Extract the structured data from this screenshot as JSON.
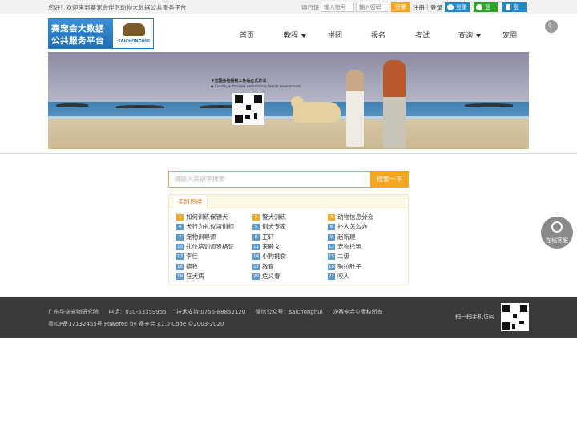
{
  "topbar": {
    "welcome": "您好！欢迎来到赛宠会伴侣动物大数据公共服务平台",
    "pass_label": "通行证",
    "account_placeholder": "输入账号",
    "password_placeholder": "输入密码",
    "login_button": "登录",
    "register": "注册",
    "separator": "|",
    "login_link": "登录",
    "social": [
      {
        "label": "登录",
        "icon": "qq-icon",
        "color": "#1e88c9"
      },
      {
        "label": "登录",
        "icon": "wechat-icon",
        "color": "#2aa52a"
      },
      {
        "label": "登录",
        "icon": "mobile-icon",
        "color": "#1e88c9"
      }
    ]
  },
  "logo": {
    "line1": "赛宠会大数据",
    "line2": "公共服务平台",
    "emblem_text": "SAICHONGHUI"
  },
  "nav": [
    {
      "label": "首页",
      "dropdown": false
    },
    {
      "label": "教程",
      "dropdown": true
    },
    {
      "label": "拼团",
      "dropdown": false
    },
    {
      "label": "报名",
      "dropdown": false
    },
    {
      "label": "考试",
      "dropdown": false
    },
    {
      "label": "查询",
      "dropdown": true
    },
    {
      "label": "宠圈",
      "dropdown": false
    }
  ],
  "banner": {
    "headline": "★全国各地授权工作站正式开发",
    "subline": "● Country authorized workstations formal development"
  },
  "search": {
    "placeholder": "请输入关键字搜索",
    "button": "搜索一下"
  },
  "hot": {
    "tab": "实时热搜",
    "items": [
      {
        "n": "1",
        "text": "如何训练保镖犬"
      },
      {
        "n": "2",
        "text": "警犬驯练"
      },
      {
        "n": "3",
        "text": "动物信息分会"
      },
      {
        "n": "4",
        "text": "犬行为礼仪培训师"
      },
      {
        "n": "5",
        "text": "训犬专家"
      },
      {
        "n": "6",
        "text": "扑人怎么办"
      },
      {
        "n": "7",
        "text": "宠物训导师"
      },
      {
        "n": "8",
        "text": "王轩"
      },
      {
        "n": "9",
        "text": "赵新建"
      },
      {
        "n": "10",
        "text": "礼仪培训师资格证"
      },
      {
        "n": "11",
        "text": "宋殿文"
      },
      {
        "n": "12",
        "text": "宠物托运"
      },
      {
        "n": "13",
        "text": "李佳"
      },
      {
        "n": "14",
        "text": "小狗挑食"
      },
      {
        "n": "15",
        "text": "二级"
      },
      {
        "n": "16",
        "text": "德牧"
      },
      {
        "n": "17",
        "text": "教育"
      },
      {
        "n": "18",
        "text": "狗拉肚子"
      },
      {
        "n": "19",
        "text": "狂犬病"
      },
      {
        "n": "20",
        "text": "危义春"
      },
      {
        "n": "21",
        "text": "咬人"
      }
    ]
  },
  "service": {
    "label": "在线客服"
  },
  "footer": {
    "org": "广东华宠宠物研究院",
    "phone": "电话：010-53359955",
    "support": "技术支持:0755-88852120",
    "wechat": "微信公众号：saichonghui",
    "copyright": "@赛宠会©版权所有",
    "icp": "粤ICP备17132455号 Powered by 赛宠会 X1.0 Code ©2003-2020",
    "scan": "扫一扫手机访问"
  }
}
